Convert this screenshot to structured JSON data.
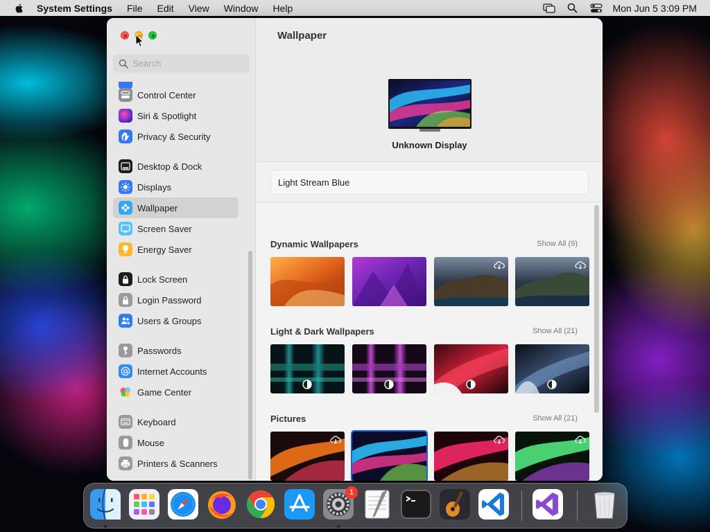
{
  "menubar": {
    "app_name": "System Settings",
    "menus": [
      "File",
      "Edit",
      "View",
      "Window",
      "Help"
    ],
    "clock": "Mon Jun 5  3:09 PM",
    "right_icons": [
      "screen-mirroring-icon",
      "search-icon",
      "control-center-icon"
    ]
  },
  "sidebar": {
    "search_placeholder": "Search",
    "items": [
      {
        "label": "Control Center",
        "icon": "control-center-icon",
        "color": "#8e8e93"
      },
      {
        "label": "Siri & Spotlight",
        "icon": "siri-icon",
        "color": "#5a2db8"
      },
      {
        "label": "Privacy & Security",
        "icon": "hand-icon",
        "color": "#3478f6"
      },
      {
        "label": "Desktop & Dock",
        "icon": "desktop-dock-icon",
        "color": "#1c1c1e"
      },
      {
        "label": "Displays",
        "icon": "sun-icon",
        "color": "#2f7cf6"
      },
      {
        "label": "Wallpaper",
        "icon": "wallpaper-icon",
        "color": "#35a8f0"
      },
      {
        "label": "Screen Saver",
        "icon": "screen-saver-icon",
        "color": "#56c3f4"
      },
      {
        "label": "Energy Saver",
        "icon": "bulb-icon",
        "color": "#fcb72f"
      },
      {
        "label": "Lock Screen",
        "icon": "lock-icon",
        "color": "#1c1c1e"
      },
      {
        "label": "Login Password",
        "icon": "login-lock-icon",
        "color": "#9a9a9e"
      },
      {
        "label": "Users & Groups",
        "icon": "users-icon",
        "color": "#2f7cf6"
      },
      {
        "label": "Passwords",
        "icon": "key-icon",
        "color": "#9a9a9e"
      },
      {
        "label": "Internet Accounts",
        "icon": "at-icon",
        "color": "#2f8ef6"
      },
      {
        "label": "Game Center",
        "icon": "game-center-icon",
        "color": "#ffffff"
      },
      {
        "label": "Keyboard",
        "icon": "keyboard-icon",
        "color": "#9a9a9e"
      },
      {
        "label": "Mouse",
        "icon": "mouse-icon",
        "color": "#9a9a9e"
      },
      {
        "label": "Printers & Scanners",
        "icon": "printer-icon",
        "color": "#9a9a9e"
      }
    ],
    "selected": "Wallpaper"
  },
  "content": {
    "title": "Wallpaper",
    "display_name": "Unknown Display",
    "current_wallpaper": "Light Stream Blue",
    "sections": [
      {
        "title": "Dynamic Wallpapers",
        "show_all": "Show All (9)"
      },
      {
        "title": "Light & Dark Wallpapers",
        "show_all": "Show All (21)"
      },
      {
        "title": "Pictures",
        "show_all": "Show All (21)"
      }
    ]
  },
  "dock": {
    "apps": [
      "Finder",
      "Launchpad",
      "Safari",
      "Firefox",
      "Chrome",
      "App Store",
      "System Settings",
      "TextEdit",
      "Terminal",
      "GarageBand",
      "Visual Studio Code",
      "Visual Studio",
      "Trash"
    ],
    "badge_count": "1"
  },
  "colors": {
    "accent": "#1a5df0",
    "close": "#fe5f57",
    "minimize": "#febc2e",
    "maximize": "#28c840",
    "badge": "#f33a31"
  }
}
